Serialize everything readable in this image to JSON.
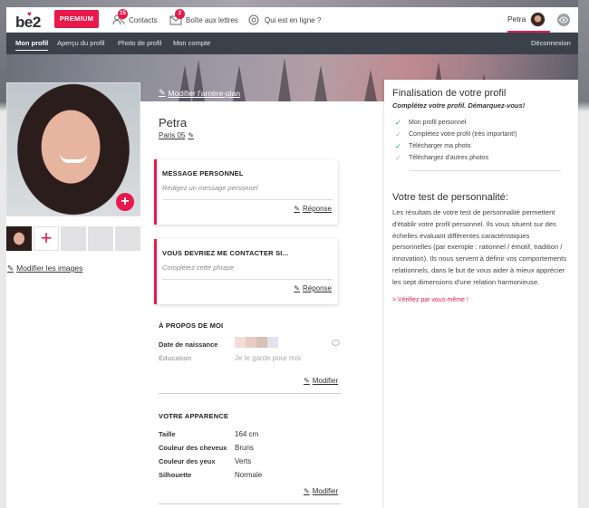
{
  "header": {
    "logo": "be2",
    "premium_label": "PREMIUM",
    "nav": [
      {
        "label": "Contacts",
        "badge": "15",
        "icon": "contacts-icon"
      },
      {
        "label": "Boîte aux lettres",
        "badge": "2",
        "icon": "mailbox-icon"
      },
      {
        "label": "Qui est en ligne ?",
        "icon": "online-icon"
      }
    ],
    "user_name": "Petra"
  },
  "subnav": {
    "items": [
      "Mon profil",
      "Aperçu du profil",
      "Photo de profil",
      "Mon compte"
    ],
    "logout": "Déconnexion",
    "active_index": 0
  },
  "banner": {
    "edit_background": "Modifier l'arrière-plan"
  },
  "photos": {
    "edit_images": "Modifier les images",
    "thumb_count": 5
  },
  "profile": {
    "name": "Petra",
    "city": "Paris 05"
  },
  "cards": [
    {
      "title": "MESSAGE PERSONNEL",
      "subtitle": "Rédigez un message personnel",
      "action": "Réponse"
    },
    {
      "title": "VOUS DEVRIEZ ME CONTACTER SI...",
      "subtitle": "Complétez cette phrase",
      "action": "Réponse"
    }
  ],
  "about": {
    "title": "À PROPOS DE MOI",
    "birth_label": "Date de naissance",
    "education_label": "Éducation",
    "education_value": "Je le garde pour moi",
    "modify": "Modifier"
  },
  "appearance": {
    "title": "VOTRE APPARENCE",
    "rows": [
      {
        "label": "Taille",
        "value": "164 cm"
      },
      {
        "label": "Couleur des cheveux",
        "value": "Bruns"
      },
      {
        "label": "Couleur des yeux",
        "value": "Verts"
      },
      {
        "label": "Silhouette",
        "value": "Normale"
      }
    ],
    "modify": "Modifier"
  },
  "right_panel": {
    "title": "Finalisation de votre profil",
    "subtitle": "Complétez votre profil. Démarquez-vous!",
    "checklist": [
      {
        "label": "Mon profil personnel",
        "done": true
      },
      {
        "label": "Complétez votre profil (très important!)",
        "done": false
      },
      {
        "label": "Télécharger ma photo",
        "done": true
      },
      {
        "label": "Téléchargez d'autres photos",
        "done": false
      }
    ],
    "test_title": "Votre test de personnalité:",
    "test_text": "Les résultats de votre test de personnalité permettent d'établir votre profil personnel. Ils vous situent sur des échelles évaluant différentes caractéristiques personnelles (par exemple : rationnel / émotif, tradition / innovation). Ils nous servent à définir vos comportements relationnels, dans le but de vous aider à mieux apprécier les sept dimensions d'une relation harmonieuse.",
    "test_link": "> Vérifiez par vous-même !"
  },
  "colors": {
    "accent": "#e8194b",
    "nav_bg": "#3a414b",
    "check_green": "#2aa35b"
  }
}
